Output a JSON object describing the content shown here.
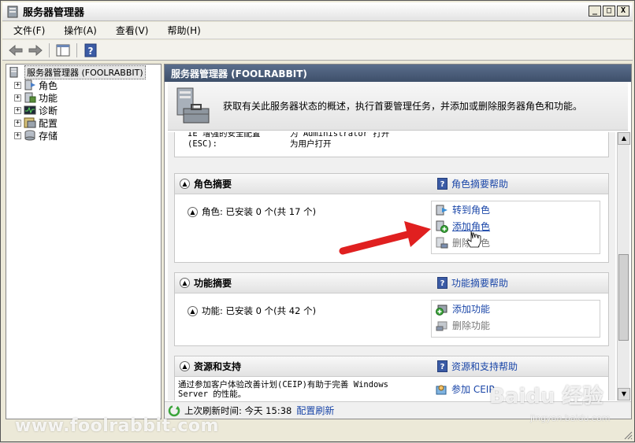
{
  "window": {
    "title": "服务器管理器"
  },
  "titlebar_buttons": [
    "_",
    "□",
    "X"
  ],
  "menu": [
    {
      "label": "文件(F)"
    },
    {
      "label": "操作(A)"
    },
    {
      "label": "查看(V)"
    },
    {
      "label": "帮助(H)"
    }
  ],
  "tree": {
    "root": "服务器管理器 (FOOLRABBIT)",
    "nodes": [
      {
        "label": "角色",
        "icon": "roles-icon"
      },
      {
        "label": "功能",
        "icon": "features-icon"
      },
      {
        "label": "诊断",
        "icon": "diagnostics-icon"
      },
      {
        "label": "配置",
        "icon": "configuration-icon"
      },
      {
        "label": "存储",
        "icon": "storage-icon"
      }
    ]
  },
  "content": {
    "header": "服务器管理器 (FOOLRABBIT)",
    "intro": "获取有关此服务器状态的概述，执行首要管理任务，并添加或删除服务器角色和功能。",
    "partial": {
      "left": "IE 增强的安全配置(ESC):",
      "right_1": "为 Administrator 打开",
      "right_2": "为用户打开"
    },
    "roles": {
      "title": "角色摘要",
      "help": "角色摘要帮助",
      "summary": "角色: 已安装 0 个(共 17 个)",
      "actions": [
        "转到角色",
        "添加角色",
        "删除角色"
      ]
    },
    "features": {
      "title": "功能摘要",
      "help": "功能摘要帮助",
      "summary": "功能: 已安装 0 个(共 42 个)",
      "actions": [
        "添加功能",
        "删除功能"
      ]
    },
    "resources": {
      "title": "资源和支持",
      "help": "资源和支持帮助",
      "text_1": "通过参加客户体验改善计划(CEIP)有助于完善 Windows",
      "text_2": "Server 的性能。",
      "action": "参加 CEIP"
    },
    "status": {
      "last_refresh": "上次刷新时间: 今天 15:38",
      "configure": "配置刷新"
    }
  },
  "watermarks": {
    "site": "www.foolrabbit.com",
    "baidu_logo": "Baidu 经验",
    "baidu_url": "jingyan.baidu.com"
  },
  "colors": {
    "header_bg": "#3e4f6a",
    "link": "#1a46a8",
    "arrow": "#e02020"
  }
}
